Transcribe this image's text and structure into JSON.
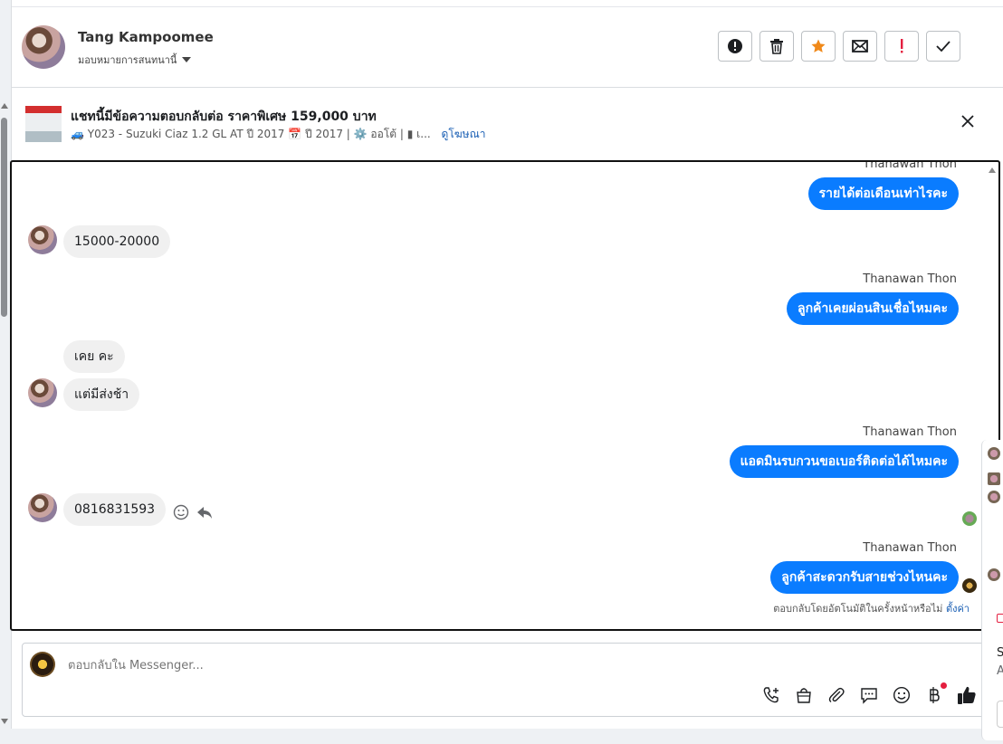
{
  "header": {
    "user_name": "Tang Kampoomee",
    "assign_label": "มอบหมายการสนทนานี้",
    "actions": [
      {
        "name": "report-button",
        "icon": "alert-circle-icon"
      },
      {
        "name": "delete-button",
        "icon": "trash-icon"
      },
      {
        "name": "star-button",
        "icon": "star-icon",
        "color": "#f0891a"
      },
      {
        "name": "mark-unread-button",
        "icon": "envelope-icon"
      },
      {
        "name": "spam-button",
        "icon": "exclamation-icon",
        "color": "#e41e3f"
      },
      {
        "name": "done-button",
        "icon": "check-icon"
      }
    ]
  },
  "ad": {
    "title": "แชทนี้มีข้อความตอบกลับต่อ ราคาพิเศษ 159,000 บาท",
    "subtitle": "🚙 Y023 - Suzuki Ciaz 1.2 GL AT ปี 2017 📅 ปี 2017 | ⚙️ ออโต้ | ▮ เ...",
    "link_label": "ดูโฆษณา"
  },
  "messages": [
    {
      "dir": "out",
      "sender": "Thanawan Thon",
      "text": "รายได้ต่อเดือนเท่าไรคะ"
    },
    {
      "dir": "in",
      "text": "15000-20000"
    },
    {
      "dir": "out",
      "sender": "Thanawan Thon",
      "text": "ลูกค้าเคยผ่อนสินเชื่อไหมคะ"
    },
    {
      "dir": "in",
      "text": "เคย คะ"
    },
    {
      "dir": "in",
      "text": "แต่มีส่งช้า"
    },
    {
      "dir": "out",
      "sender": "Thanawan Thon",
      "text": "แอดมินรบกวนขอเบอร์ติดต่อได้ไหมคะ"
    },
    {
      "dir": "in",
      "text": "0816831593"
    },
    {
      "dir": "out",
      "sender": "Thanawan Thon",
      "text": "ลูกค้าสะดวกรับสายช่วงไหนคะ"
    }
  ],
  "auto_reply": {
    "text": "ตอบกลับโดยอัตโนมัติในครั้งหน้าหรือไม่",
    "link": "ตั้งค่า"
  },
  "composer": {
    "placeholder": "ตอบกลับใน Messenger...",
    "tools": [
      "call-add-icon",
      "shopping-bag-icon",
      "paperclip-icon",
      "saved-reply-icon",
      "emoji-icon",
      "baht-icon",
      "thumbs-up-icon"
    ]
  },
  "side_panel": {
    "letters": [
      "S",
      "A"
    ]
  },
  "colors": {
    "accent": "#0a7cff",
    "star": "#f0891a",
    "spam": "#e41e3f",
    "incoming_bubble": "#f0f0f0"
  }
}
